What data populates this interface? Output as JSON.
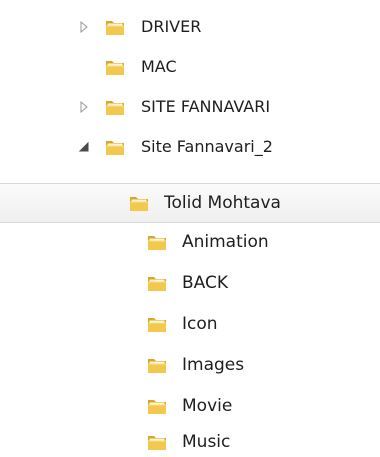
{
  "top_tree": {
    "items": [
      {
        "label": "DRIVER",
        "expander": "collapsed"
      },
      {
        "label": "MAC",
        "expander": "none"
      },
      {
        "label": "SITE FANNAVARI",
        "expander": "collapsed"
      },
      {
        "label": "Site Fannavari_2",
        "expander": "expanded"
      }
    ]
  },
  "bottom_tree": {
    "selected": {
      "label": "Tolid Mohtava"
    },
    "children": [
      {
        "label": "Animation"
      },
      {
        "label": "BACK"
      },
      {
        "label": "Icon"
      },
      {
        "label": "Images"
      },
      {
        "label": "Movie"
      },
      {
        "label": "Music"
      }
    ]
  },
  "icons": {
    "folder": "folder-icon",
    "expander_collapsed": "expand-arrow-icon",
    "expander_expanded": "collapse-arrow-icon"
  },
  "colors": {
    "folder_fill": "#f2c94c",
    "folder_back": "#dba52c",
    "folder_paper": "#fff7d6",
    "selection_top": "#fbfbfb",
    "selection_bottom": "#efefef",
    "selection_border": "#d8d8d8",
    "text": "#1e1e1e",
    "arrow_outline": "#9a9a9a",
    "arrow_filled": "#4a4a4a"
  }
}
